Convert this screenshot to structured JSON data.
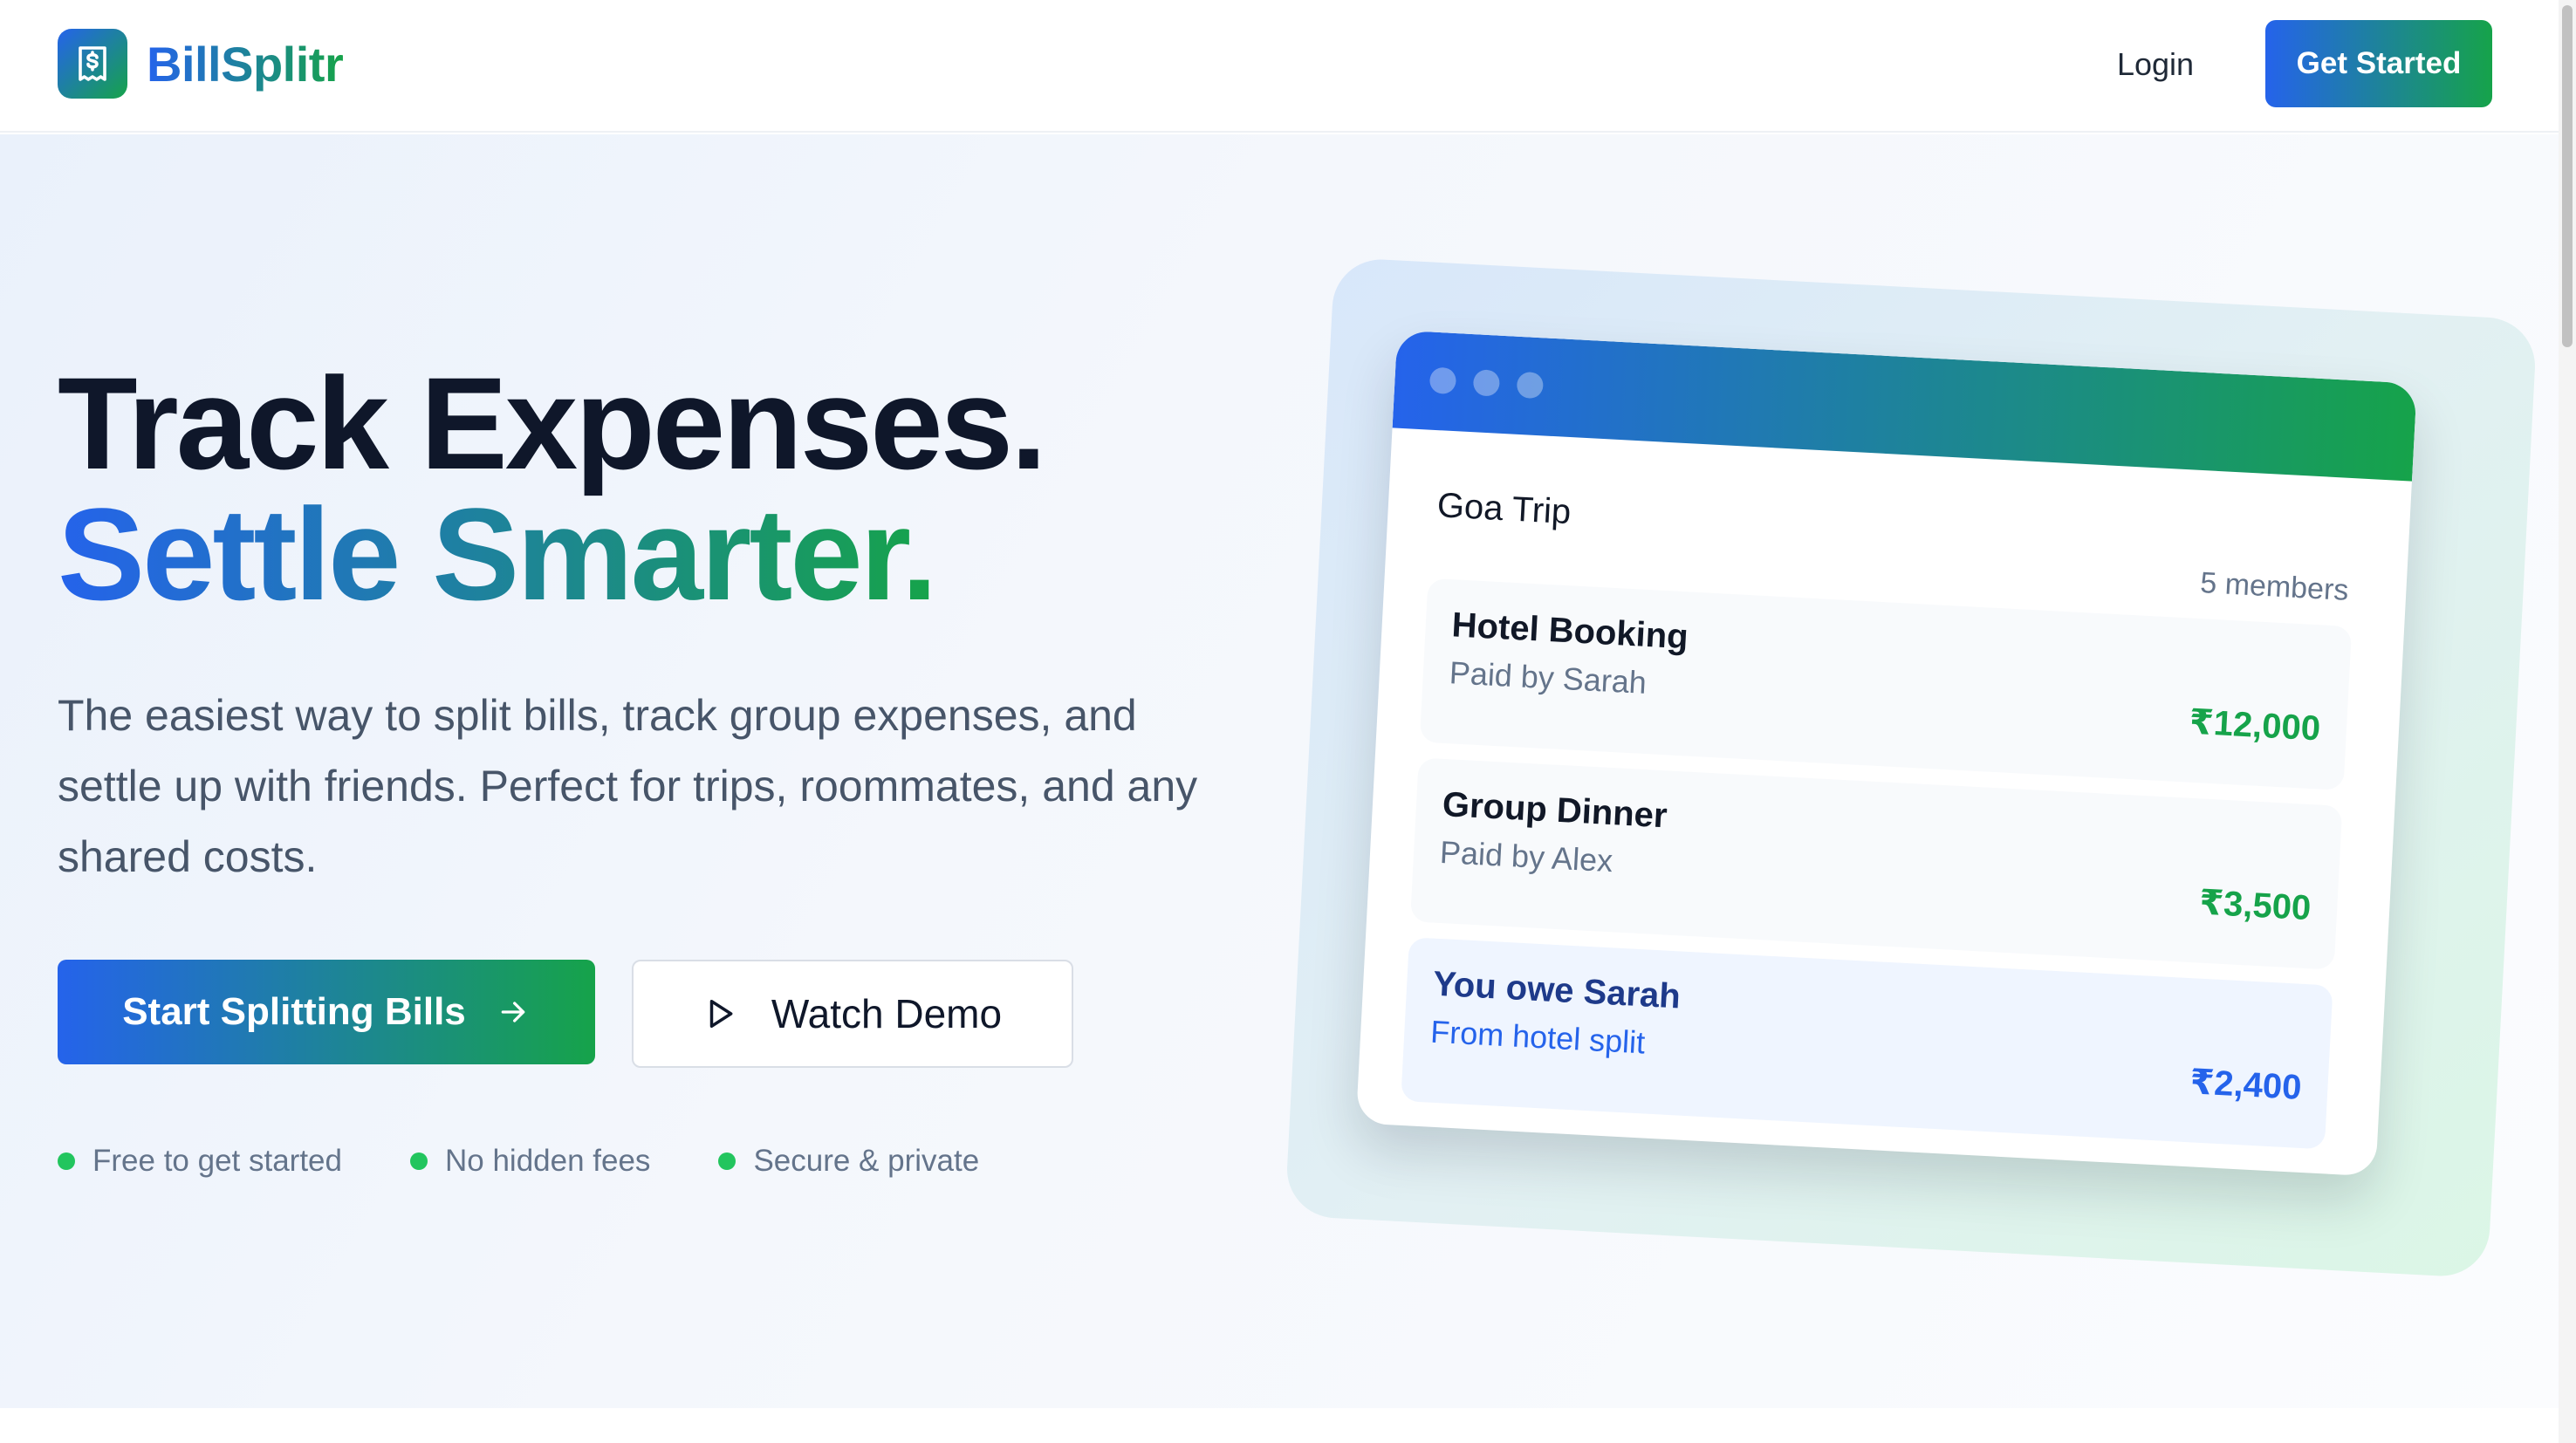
{
  "nav": {
    "brand": "BillSplitr",
    "brand_icon": "receipt-dollar-icon",
    "login_label": "Login",
    "cta_label": "Get Started"
  },
  "hero": {
    "headline_line1": "Track Expenses.",
    "headline_line2": "Settle Smarter.",
    "description": "The easiest way to split bills, track group expenses, and settle up with friends. Perfect for trips, roommates, and any shared costs.",
    "primary_button": "Start Splitting Bills",
    "primary_button_icon": "arrow-right-icon",
    "secondary_button": "Watch Demo",
    "secondary_button_icon": "play-icon",
    "features": [
      "Free to get started",
      "No hidden fees",
      "Secure & private"
    ]
  },
  "preview": {
    "group_name": "Goa Trip",
    "members": "5 members",
    "expenses": [
      {
        "title": "Hotel Booking",
        "subtitle": "Paid by Sarah",
        "amount": "₹12,000"
      },
      {
        "title": "Group Dinner",
        "subtitle": "Paid by Alex",
        "amount": "₹3,500"
      },
      {
        "title": "You owe Sarah",
        "subtitle": "From hotel split",
        "amount": "₹2,400"
      }
    ]
  },
  "colors": {
    "gradient_start": "#2563eb",
    "gradient_end": "#16a34a",
    "feature_dot": "#22c55e",
    "heading": "#0f172a",
    "body_text": "#475569"
  }
}
